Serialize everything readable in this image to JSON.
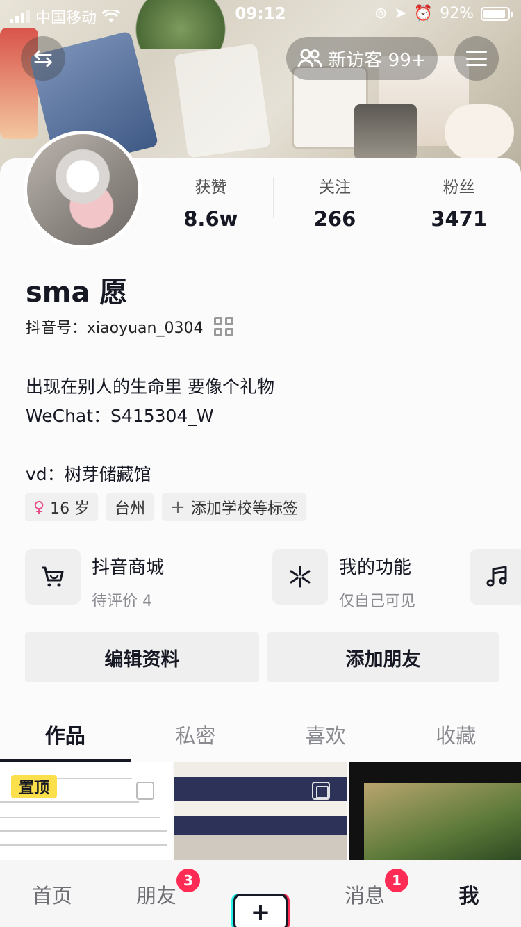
{
  "status_bar": {
    "carrier": "中国移动",
    "time": "09:12",
    "battery": "92%"
  },
  "header": {
    "visitor_label": "新访客 99+"
  },
  "stats": [
    {
      "label": "获赞",
      "value": "8.6w"
    },
    {
      "label": "关注",
      "value": "266"
    },
    {
      "label": "粉丝",
      "value": "3471"
    }
  ],
  "profile": {
    "nickname": "sma 愿",
    "douyin_id": "抖音号：xiaoyuan_0304",
    "bio_line1": "出现在别人的生命里 要像个礼物",
    "bio_line2": "WeChat：S415304_W",
    "bio_line3": "vd：树芽储藏馆"
  },
  "tags": {
    "age": "16 岁",
    "city": "台州",
    "add_label": "添加学校等标签"
  },
  "features": [
    {
      "title": "抖音商城",
      "subtitle": "待评价 4",
      "icon": "cart-icon"
    },
    {
      "title": "我的功能",
      "subtitle": "仅自己可见",
      "icon": "asterisk-icon"
    },
    {
      "icon": "music-icon"
    }
  ],
  "actions": {
    "edit": "编辑资料",
    "add_friend": "添加朋友"
  },
  "tabs": [
    "作品",
    "私密",
    "喜欢",
    "收藏"
  ],
  "grid": {
    "pinned_label": "置顶"
  },
  "nav": {
    "home": "首页",
    "friends": "朋友",
    "friends_badge": "3",
    "plus": "+",
    "messages": "消息",
    "messages_badge": "1",
    "me": "我"
  }
}
